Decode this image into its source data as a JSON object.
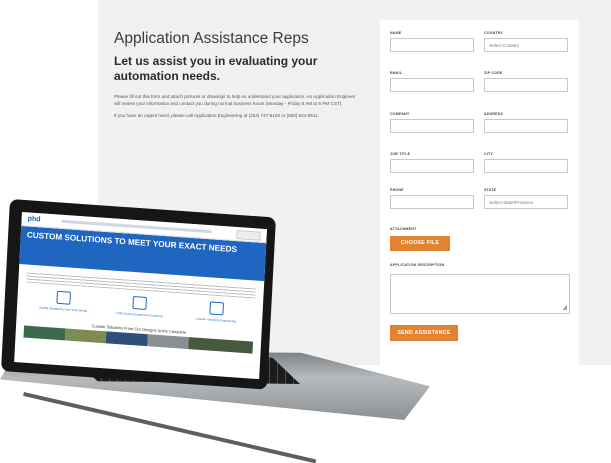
{
  "intro": {
    "title": "Application Assistance Reps",
    "subtitle": "Let us assist you in evaluating your automation needs.",
    "paragraph1": "Please fill out this form and attach pictures or drawings to help us understand your application. An Application Engineer will review your information and contact you during normal business hours (Monday - Friday 8 AM to 5 PM CST).",
    "paragraph2": "If you have an urgent need, please call Application Engineering at (262) 747-8100 or (800) 624-8511."
  },
  "form": {
    "name_label": "NAME",
    "country_label": "COUNTRY",
    "country_value": "Select Country",
    "email_label": "EMAIL",
    "zip_label": "ZIP CODE",
    "company_label": "COMPANY",
    "address_label": "ADDRESS",
    "jobtitle_label": "JOB TITLE",
    "city_label": "CITY",
    "phone_label": "PHONE",
    "state_label": "STATE",
    "state_value": "Select State/Province",
    "attachment_label": "ATTACHMENT",
    "choose_file_label": "CHOOSE FILE",
    "description_label": "APPLICATION DESCRIPTION",
    "send_label": "SEND ASSISTANCE"
  },
  "laptop_screen": {
    "logo": "phd",
    "hero_title": "CUSTOM SOLUTIONS TO MEET YOUR EXACT NEEDS",
    "cards": [
      "Modify Standard to Suit Your Needs",
      "Fully Custom Engineered Solutions",
      "Custom Solutions Engineering"
    ],
    "section_title": "Custom Solutions From Our Designs to the Complete"
  },
  "colors": {
    "accent_orange": "#e2832f",
    "hero_blue": "#1f66c1",
    "page_background": "#f1f1f1"
  }
}
